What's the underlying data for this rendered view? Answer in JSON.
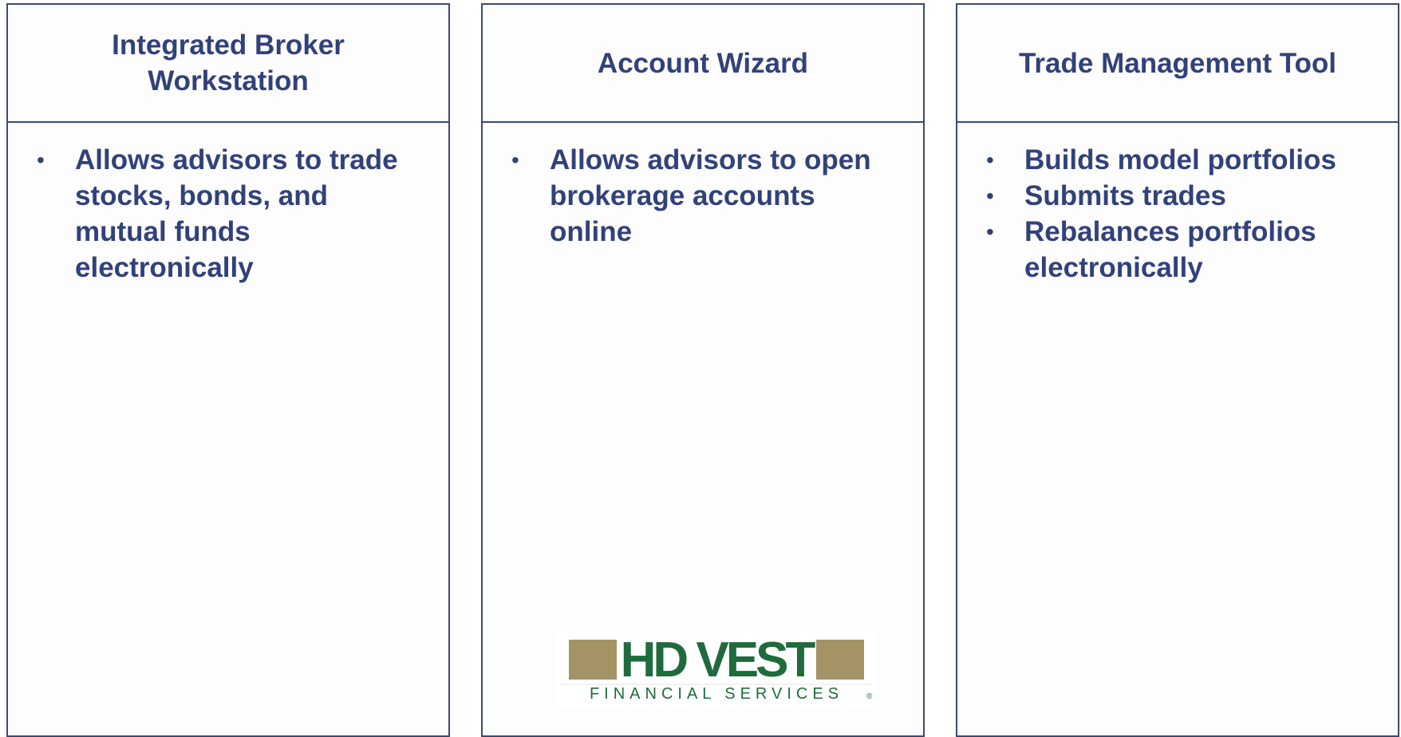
{
  "panels": [
    {
      "title_lines": [
        "Integrated Broker",
        "Workstation"
      ],
      "bullets": [
        {
          "lines": [
            "Allows advisors to trade",
            "stocks, bonds, and",
            "mutual funds",
            "electronically"
          ]
        }
      ]
    },
    {
      "title_lines": [
        "Account Wizard"
      ],
      "bullets": [
        {
          "lines": [
            "Allows advisors to open",
            "brokerage accounts",
            "online"
          ]
        }
      ]
    },
    {
      "title_lines": [
        "Trade Management Tool"
      ],
      "bullets": [
        {
          "lines": [
            "Builds model portfolios"
          ]
        },
        {
          "lines": [
            "Submits trades"
          ]
        },
        {
          "lines": [
            "Rebalances portfolios",
            "electronically"
          ]
        }
      ]
    }
  ],
  "bullet_symbol": "•",
  "logo": {
    "main": "HD VEST",
    "sub": "FINANCIAL   SERVICES",
    "mark": "®",
    "colors": {
      "green": "#1f6b3c",
      "gold": "#a39365"
    }
  },
  "colors": {
    "text": "#31417a",
    "border": "#3a4a75"
  }
}
